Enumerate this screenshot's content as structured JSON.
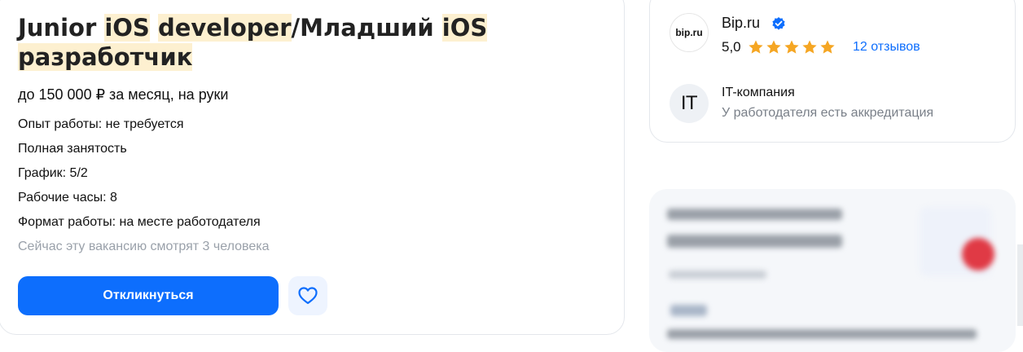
{
  "vacancy": {
    "title_parts": [
      "Junior ",
      "iOS",
      " ",
      "developer",
      "/Младший ",
      "iOS",
      " ",
      "разработчик"
    ],
    "salary": "до 150 000 ₽ за месяц, на руки",
    "details": [
      "Опыт работы: не требуется",
      "Полная занятость",
      "График: 5/2",
      "Рабочие часы: 8",
      "Формат работы: на месте работодателя"
    ],
    "viewers": "Сейчас эту вакансию смотрят 3 человека",
    "respond_label": "Откликнуться"
  },
  "employer": {
    "logo_text": "bip.ru",
    "name": "Bip.ru",
    "rating": "5,0",
    "stars": 5,
    "reviews": "12 отзывов",
    "it_badge": "IT",
    "category": "IT-компания",
    "accreditation": "У работодателя есть аккредитация"
  },
  "colors": {
    "accent": "#0d6efd",
    "star": "#f5a623",
    "highlight": "#fdf0d0",
    "muted": "#9aa1aa"
  },
  "icons": {
    "favorite": "heart-icon",
    "verified": "verified-check-icon",
    "star": "star-icon"
  }
}
